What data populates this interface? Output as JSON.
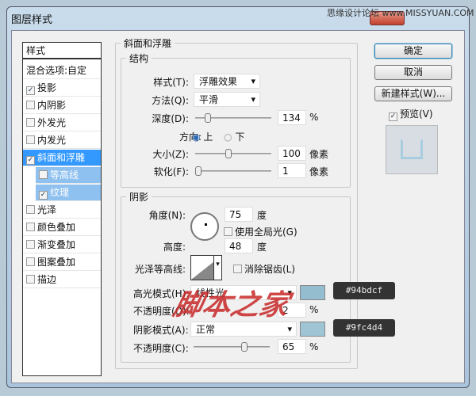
{
  "window": {
    "title": "图层样式",
    "watermark_top": "思缘设计论坛 www.MISSYUAN.COM"
  },
  "sidebar": {
    "header": "样式",
    "blend": "混合选项:自定",
    "items": [
      {
        "label": "投影",
        "checked": true
      },
      {
        "label": "内阴影",
        "checked": false
      },
      {
        "label": "外发光",
        "checked": false
      },
      {
        "label": "内发光",
        "checked": false
      },
      {
        "label": "斜面和浮雕",
        "checked": true,
        "selected": true
      },
      {
        "label": "等高线",
        "checked": false,
        "sub": true
      },
      {
        "label": "纹理",
        "checked": true,
        "sub": true
      },
      {
        "label": "光泽",
        "checked": false
      },
      {
        "label": "颜色叠加",
        "checked": false
      },
      {
        "label": "渐变叠加",
        "checked": false
      },
      {
        "label": "图案叠加",
        "checked": false
      },
      {
        "label": "描边",
        "checked": false
      }
    ]
  },
  "buttons": {
    "ok": "确定",
    "cancel": "取消",
    "new_style": "新建样式(W)...",
    "preview": "预览(V)",
    "preview_checked": true
  },
  "bevel": {
    "title": "斜面和浮雕",
    "structure": {
      "title": "结构",
      "style_label": "样式(T):",
      "style": "浮雕效果",
      "technique_label": "方法(Q):",
      "technique": "平滑",
      "depth_label": "深度(D):",
      "depth": "134",
      "depth_unit": "%",
      "direction_label": "方向:",
      "dir_up": "上",
      "dir_down": "下",
      "direction": "上",
      "size_label": "大小(Z):",
      "size": "100",
      "size_unit": "像素",
      "soften_label": "软化(F):",
      "soften": "1",
      "soften_unit": "像素"
    },
    "shading": {
      "title": "阴影",
      "angle_label": "角度(N):",
      "angle": "75",
      "angle_unit": "度",
      "global_light": "使用全局光(G)",
      "altitude_label": "高度:",
      "altitude": "48",
      "altitude_unit": "度",
      "gloss_label": "光泽等高线:",
      "antialias": "消除锯齿(L)",
      "highlight_label": "高光模式(H):",
      "highlight_mode": "线性光",
      "highlight_opacity_label": "不透明度(O):",
      "highlight_opacity": "2",
      "pct": "%",
      "shadow_label": "阴影模式(A):",
      "shadow_mode": "正常",
      "shadow_opacity_label": "不透明度(C):",
      "shadow_opacity": "65",
      "highlight_color": "#94bdcf",
      "shadow_color": "#9fc4d4"
    }
  },
  "watermark": "脚本之家"
}
